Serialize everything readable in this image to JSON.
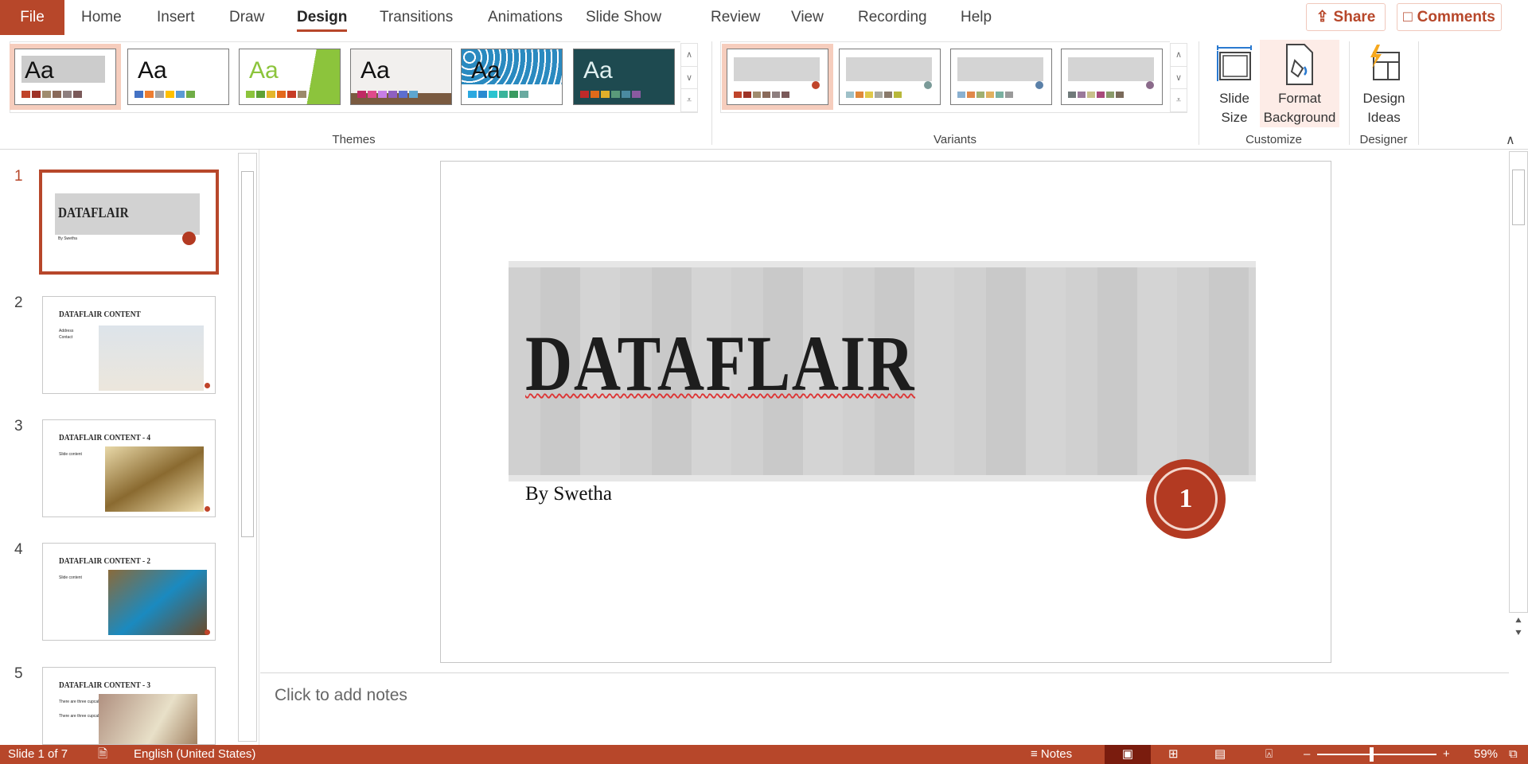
{
  "tabs": {
    "file": "File",
    "items": [
      "Home",
      "Insert",
      "Draw",
      "Design",
      "Transitions",
      "Animations",
      "Slide Show",
      "Review",
      "View",
      "Recording",
      "Help"
    ],
    "active": "Design"
  },
  "header": {
    "share": "Share",
    "comments": "Comments"
  },
  "ribbon": {
    "themes_label": "Themes",
    "variants_label": "Variants",
    "customize_label": "Customize",
    "designer_label": "Designer",
    "themes": [
      {
        "text": "Aa",
        "colors": [
          "#c0442a",
          "#9e3226",
          "#a08c6e",
          "#8a6a5a",
          "#8e7f7f",
          "#7b5a5a"
        ]
      },
      {
        "text": "Aa",
        "colors": [
          "#4472c4",
          "#ed7d31",
          "#a5a5a5",
          "#ffc000",
          "#5b9bd5",
          "#70ad47"
        ]
      },
      {
        "text": "Aa",
        "colors": [
          "#8cc43c",
          "#5ea134",
          "#e4b62b",
          "#e4681b",
          "#c73c25",
          "#9c8a6a"
        ]
      },
      {
        "text": "Aa",
        "colors": [
          "#c02a64",
          "#e04a8c",
          "#c77ee6",
          "#8e60c0",
          "#5c6ed0",
          "#5ea6d0"
        ]
      },
      {
        "text": "Aa",
        "colors": [
          "#2aa8e0",
          "#2a8ad0",
          "#2ac4d0",
          "#3ab49a",
          "#3a9a60",
          "#6aaaa0"
        ]
      },
      {
        "text": "Aa",
        "colors": [
          "#c02a2a",
          "#e06a1a",
          "#e0b02a",
          "#5a9a7a",
          "#4a8aa0",
          "#8a5aa0"
        ]
      }
    ],
    "variants": [
      {
        "colors": [
          "#c0442a",
          "#9e3226",
          "#a08c6e",
          "#8a6a5a",
          "#8e7f7f",
          "#7b5a5a"
        ],
        "dot": "#c0442a"
      },
      {
        "colors": [
          "#9ec0c8",
          "#e0883a",
          "#e0c84a",
          "#a8a8a0",
          "#8a7a6a",
          "#b8b83a"
        ],
        "dot": "#7a9a98"
      },
      {
        "colors": [
          "#8ab0d0",
          "#e0884a",
          "#a0b070",
          "#e0b060",
          "#7ab0a0",
          "#9a9a9a"
        ],
        "dot": "#5a80a8"
      },
      {
        "colors": [
          "#707a7a",
          "#9a7a9a",
          "#c8c08a",
          "#a84a7a",
          "#8a9a6a",
          "#7a6a5a"
        ],
        "dot": "#8a6a8a"
      }
    ],
    "slide_size": "Slide Size",
    "format_background": "Format Background",
    "design_ideas": "Design Ideas"
  },
  "slides": [
    {
      "num": "1",
      "title": "DATAFLAIR",
      "sub": "By Swetha"
    },
    {
      "num": "2",
      "title": "DATAFLAIR CONTENT",
      "bullets": [
        "Address",
        "Contact"
      ]
    },
    {
      "num": "3",
      "title": "DATAFLAIR CONTENT - 4",
      "bullets": [
        "Slide content"
      ]
    },
    {
      "num": "4",
      "title": "DATAFLAIR CONTENT - 2",
      "bullets": [
        "Slide content"
      ]
    },
    {
      "num": "5",
      "title": "DATAFLAIR CONTENT - 3",
      "bullets": [
        "There are three cupcakes",
        "There are three cupcakes"
      ]
    }
  ],
  "current_slide": {
    "title": "DATAFLAIR",
    "subtitle": "By Swetha",
    "seal": "1"
  },
  "notes_placeholder": "Click to add notes",
  "status": {
    "slide": "Slide 1 of 7",
    "language": "English (United States)",
    "notes": "Notes",
    "zoom": "59%",
    "zoom_percent": 59
  },
  "colors": {
    "accent": "#b7472a"
  }
}
